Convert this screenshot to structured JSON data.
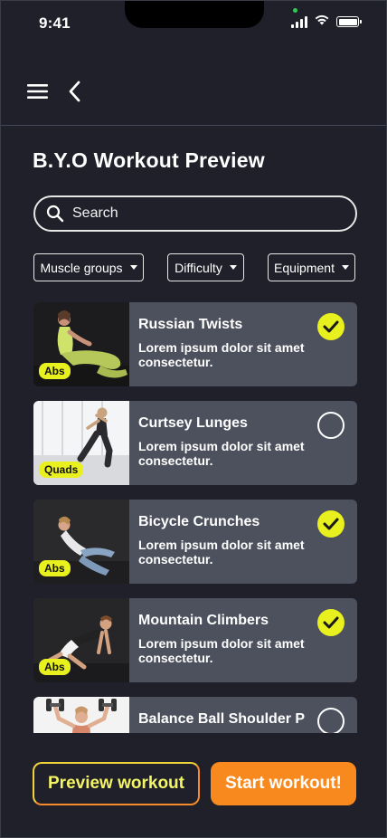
{
  "status_bar": {
    "time": "9:41",
    "icons": [
      "cellular-signal-icon",
      "wifi-icon",
      "battery-icon"
    ],
    "battery_fraction": 1.0
  },
  "nav": {
    "menu_icon": "hamburger-menu-icon",
    "back_icon": "chevron-left-icon"
  },
  "page": {
    "title": "B.Y.O Workout Preview"
  },
  "search": {
    "placeholder": "Search",
    "value": ""
  },
  "filters": [
    {
      "label": "Muscle groups"
    },
    {
      "label": "Difficulty"
    },
    {
      "label": "Equipment"
    }
  ],
  "exercises": [
    {
      "title": "Russian Twists",
      "description": "Lorem ipsum dolor sit amet consectetur.",
      "tag": "Abs",
      "selected": true
    },
    {
      "title": "Curtsey Lunges",
      "description": "Lorem ipsum dolor sit amet consectetur.",
      "tag": "Quads",
      "selected": false
    },
    {
      "title": "Bicycle Crunches",
      "description": "Lorem ipsum dolor sit amet consectetur.",
      "tag": "Abs",
      "selected": true
    },
    {
      "title": "Mountain Climbers",
      "description": "Lorem ipsum dolor sit amet consectetur.",
      "tag": "Abs",
      "selected": true
    },
    {
      "title": "Balance Ball Shoulder P",
      "description": "",
      "tag": "",
      "selected": false
    }
  ],
  "actions": {
    "preview_label": "Preview workout",
    "start_label": "Start workout!"
  },
  "colors": {
    "background": "#1f202a",
    "card": "#4d515e",
    "accent_yellow": "#e8f01d",
    "accent_orange": "#f7891f"
  }
}
